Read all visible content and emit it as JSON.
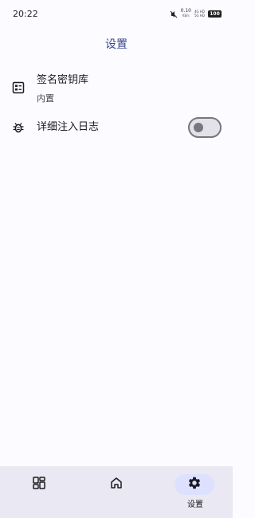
{
  "status_bar": {
    "time": "20:22",
    "speed_value": "0.10",
    "speed_unit": "KB/s",
    "net_top": "4G HD",
    "net_bottom": "5G HD",
    "battery": "100"
  },
  "header": {
    "title": "设置"
  },
  "settings": [
    {
      "title": "签名密钥库",
      "subtitle": "内置",
      "icon": "keystore-icon"
    },
    {
      "title": "详细注入日志",
      "icon": "bug-icon",
      "toggle_on": false
    }
  ],
  "bottom_nav": {
    "items": [
      {
        "icon": "grid-icon",
        "label": ""
      },
      {
        "icon": "home-icon",
        "label": ""
      },
      {
        "icon": "gear-icon",
        "label": "设置",
        "selected": true
      }
    ]
  },
  "colors": {
    "accent": "#3c4a8f",
    "background": "#fcfbff",
    "nav_background": "#eae8f2",
    "selected_pill": "#dde1ff",
    "toggle_outline": "#76777f"
  }
}
